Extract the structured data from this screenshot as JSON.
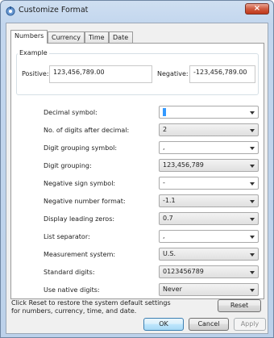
{
  "window": {
    "title": "Customize Format",
    "close_label": "×"
  },
  "tabs": [
    {
      "label": "Numbers",
      "active": true
    },
    {
      "label": "Currency",
      "active": false
    },
    {
      "label": "Time",
      "active": false
    },
    {
      "label": "Date",
      "active": false
    }
  ],
  "example": {
    "group_label": "Example",
    "positive_label": "Positive:",
    "positive_value": "123,456,789.00",
    "negative_label": "Negative:",
    "negative_value": "-123,456,789.00"
  },
  "settings": [
    {
      "label": "Decimal symbol:",
      "value": ".",
      "type": "editable"
    },
    {
      "label": "No. of digits after decimal:",
      "value": "2",
      "type": "dropdown"
    },
    {
      "label": "Digit grouping symbol:",
      "value": ",",
      "type": "editable"
    },
    {
      "label": "Digit grouping:",
      "value": "123,456,789",
      "type": "dropdown"
    },
    {
      "label": "Negative sign symbol:",
      "value": "-",
      "type": "editable"
    },
    {
      "label": "Negative number format:",
      "value": "-1.1",
      "type": "dropdown"
    },
    {
      "label": "Display leading zeros:",
      "value": "0.7",
      "type": "dropdown"
    },
    {
      "label": "List separator:",
      "value": ",",
      "type": "editable"
    },
    {
      "label": "Measurement system:",
      "value": "U.S.",
      "type": "dropdown"
    },
    {
      "label": "Standard digits:",
      "value": "0123456789",
      "type": "dropdown"
    },
    {
      "label": "Use native digits:",
      "value": "Never",
      "type": "dropdown"
    }
  ],
  "reset": {
    "text": "Click Reset to restore the system default settings for numbers, currency, time, and date.",
    "button_label": "Reset"
  },
  "footer": {
    "ok_label": "OK",
    "cancel_label": "Cancel",
    "apply_label": "Apply"
  }
}
